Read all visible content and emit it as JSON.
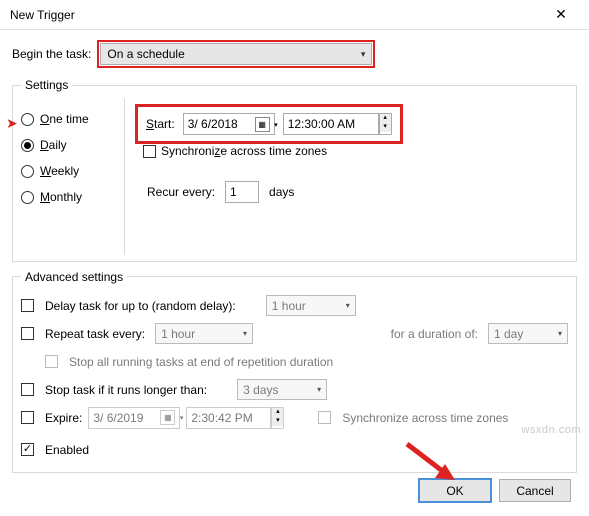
{
  "window": {
    "title": "New Trigger"
  },
  "begin": {
    "label": "Begin the task:",
    "value": "On a schedule"
  },
  "settings": {
    "legend": "Settings",
    "options": {
      "one_time": "ne time",
      "one_time_u": "O",
      "daily": "aily",
      "daily_u": "D",
      "weekly": "eekly",
      "weekly_u": "W",
      "monthly": "onthly",
      "monthly_u": "M"
    },
    "start_label_u": "S",
    "start_label": "tart:",
    "start_date": "3/ 6/2018",
    "start_time": "12:30:00 AM",
    "sync_label": "Synchroni",
    "sync_label_u": "z",
    "sync_label2": "e across time zones",
    "recur_label": "Recur every:",
    "recur_value": "1",
    "recur_unit": "days"
  },
  "advanced": {
    "legend": "Advanced settings",
    "delay_label": "Delay task for up to (random delay):",
    "delay_value": "1 hour",
    "repeat_label": "Repeat task every:",
    "repeat_value": "1 hour",
    "duration_label": "for a duration of:",
    "duration_value": "1 day",
    "stop_all_label": "Stop all running tasks at end of repetition duration",
    "stop_if_label": "Stop task if it runs longer than:",
    "stop_if_value": "3 days",
    "expire_label": "Expire:",
    "expire_date": "3/ 6/2019",
    "expire_time": "2:30:42 PM",
    "expire_sync": "Synchronize across time zones",
    "enabled_label": "Enabled"
  },
  "buttons": {
    "ok": "OK",
    "cancel": "Cancel"
  },
  "watermark": "wsxdn.com"
}
